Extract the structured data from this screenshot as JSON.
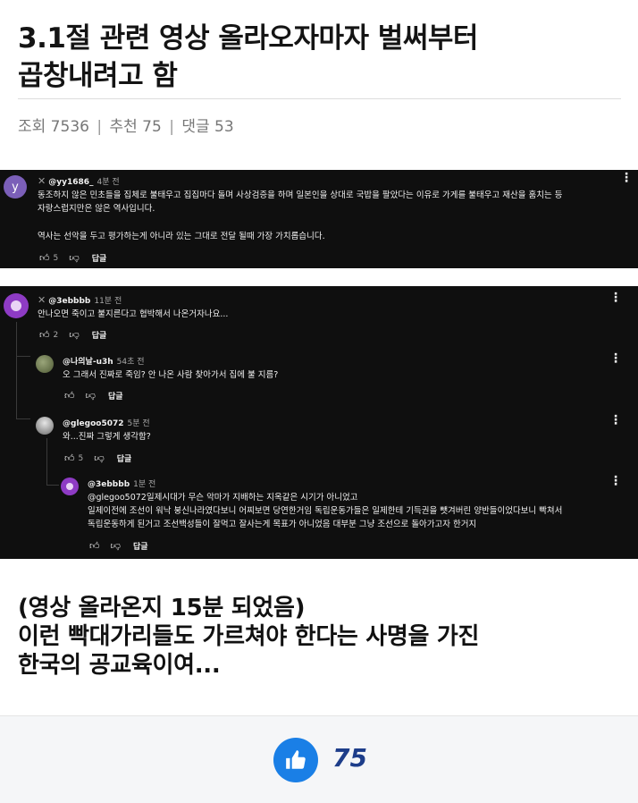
{
  "post": {
    "title_line1": "3.1절 관련 영상 올라오자마자 벌써부터",
    "title_line2": "곱창내려고 함",
    "meta": {
      "views_label": "조회 7536",
      "recommend_label": "추천 75",
      "comments_label": "댓글 53",
      "separator": "|"
    }
  },
  "comments_panel_1": {
    "comment": {
      "avatar_letter": "y",
      "handle": "@yy1686_",
      "time": "4분 전",
      "line1": "동조하지 않은 민초들을 집체로 불태우고 집집마다 돌며 사상검증을 하며 일본인을 상대로 국밥을 팔았다는 이유로 가게를 불태우고 재산을 훔치는 등",
      "line2": "자랑스럽지만은 않은 역사입니다.",
      "line3": "역사는 선악을 두고 평가하는게 아니라 있는 그대로 전달 될때 가장 가치롭습니다.",
      "likes": "5",
      "reply_label": "답글"
    }
  },
  "comments_panel_2": {
    "main": {
      "handle": "@3ebbbb",
      "time": "11분 전",
      "text": "안나오면 죽이고 불지른다고 협박해서 나온거자나요...",
      "likes": "2",
      "reply_label": "답글"
    },
    "reply1": {
      "handle": "@나의날-u3h",
      "time": "54초 전",
      "text": "오 그래서 진짜로 죽임? 안 나온 사람 찾아가서 집에 불 지름?",
      "reply_label": "답글"
    },
    "reply2": {
      "handle": "@glegoo5072",
      "time": "5분 전",
      "text": "와...진짜 그렇게 생각함?",
      "likes": "5",
      "reply_label": "답글"
    },
    "reply3": {
      "handle": "@3ebbbb",
      "time": "1분 전",
      "line1": "@glegoo5072일제시대가 무슨 악마가 지배하는 지옥같은 시기가 아니었고",
      "line2": "일제이전에 조선이 워낙 붕신나라였다보니 어찌보면 당연한거임 독립운동가들은 일제한테 기득권을 뺏겨버린 양반들이었다보니 빡쳐서",
      "line3": "독립운동하게 된거고 조선백성들이 잘먹고 잘사는게 목표가 아니었음 대부분 그냥 조선으로 돌아가고자 한거지",
      "reply_label": "답글"
    }
  },
  "caption": {
    "line1": "(영상 올라온지 15분 되었음)",
    "line2": "이런 빡대가리들도 가르쳐야 한다는 사명을 가진",
    "line3": "한국의 공교육이여..."
  },
  "like_bar": {
    "count": "75",
    "accent_color": "#1a7fe6"
  },
  "icons": [
    "close-icon",
    "thumbs-up-icon",
    "thumbs-down-icon",
    "more-vert-icon",
    "like-button-icon"
  ]
}
